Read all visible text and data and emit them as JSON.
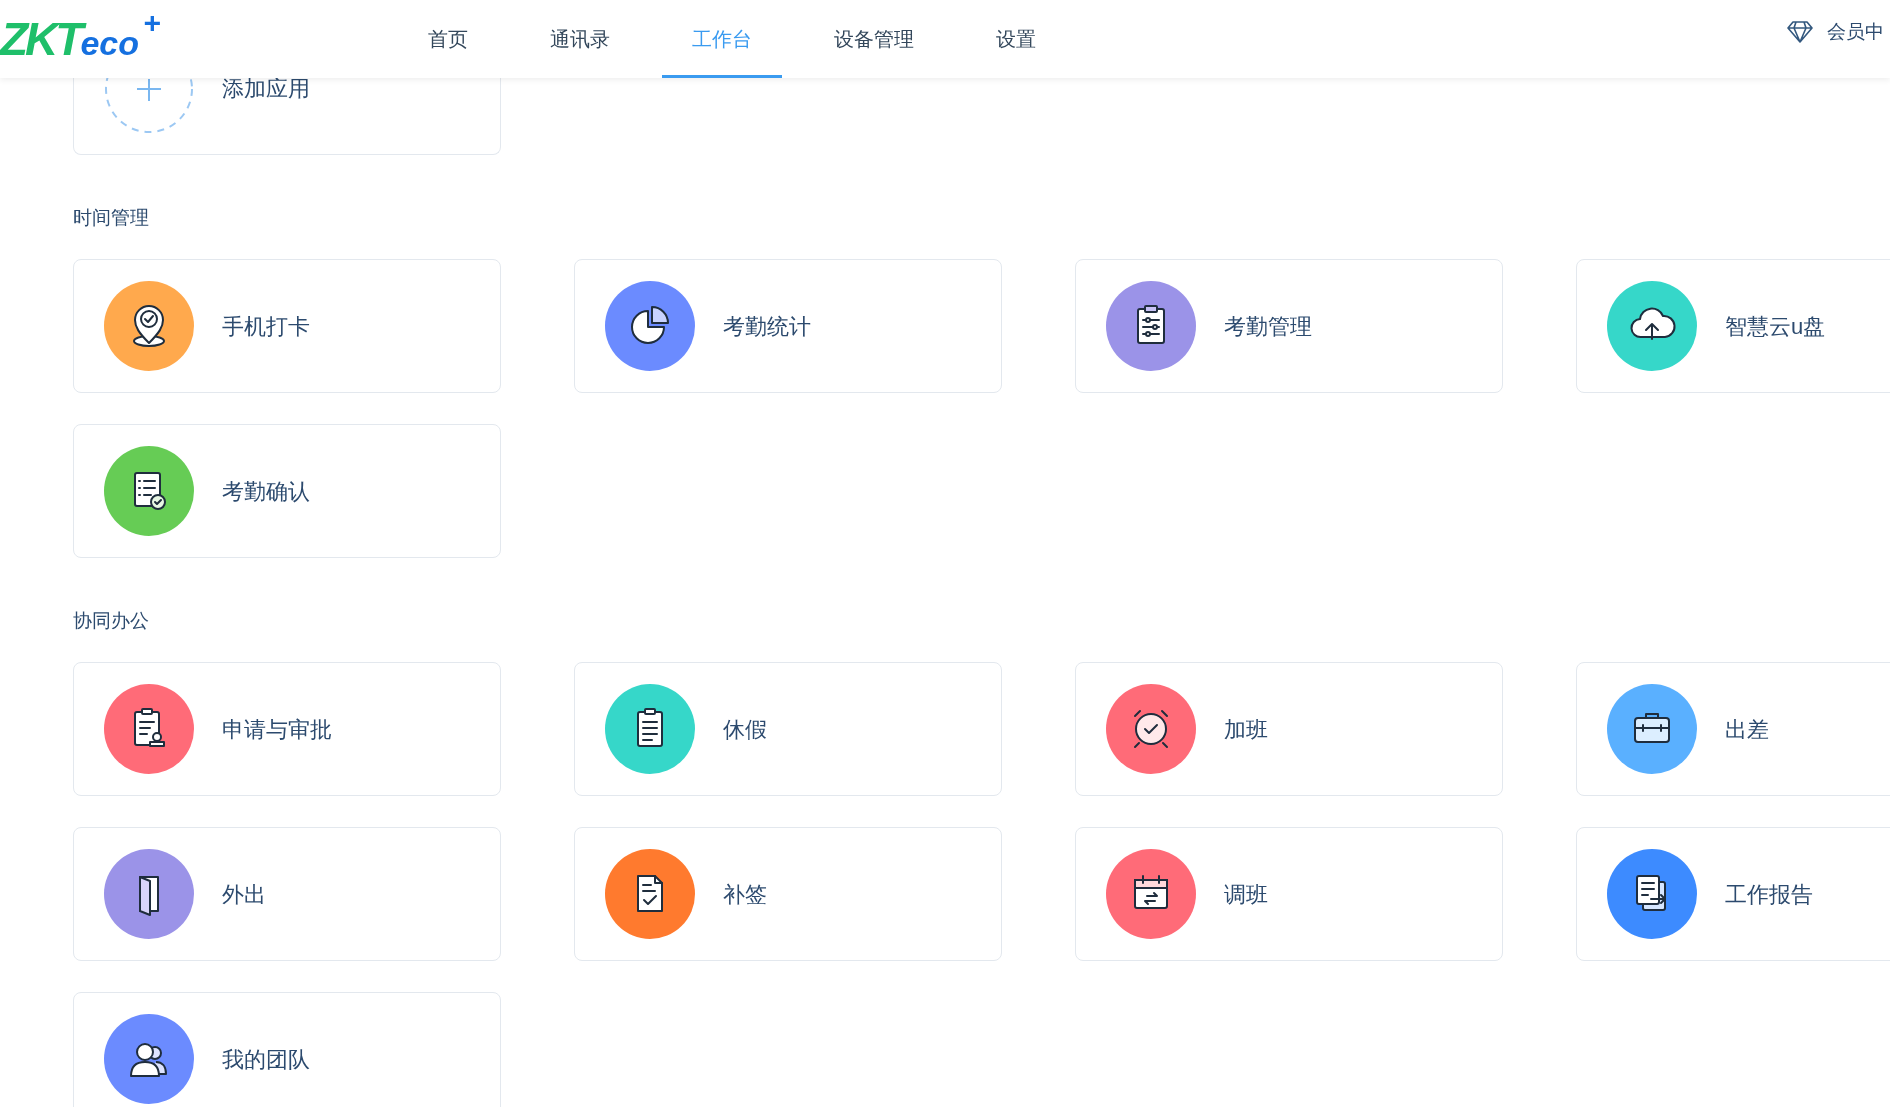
{
  "header": {
    "logo": {
      "main": "ZKT",
      "sub": "eco",
      "mark": "+"
    },
    "nav": [
      {
        "label": "首页",
        "selected": false
      },
      {
        "label": "通讯录",
        "selected": false
      },
      {
        "label": "工作台",
        "selected": true
      },
      {
        "label": "设备管理",
        "selected": false
      },
      {
        "label": "设置",
        "selected": false
      }
    ],
    "member": {
      "label": "会员中"
    }
  },
  "add_app": {
    "label": "添加应用"
  },
  "sections": [
    {
      "title": "时间管理",
      "apps": [
        {
          "label": "手机打卡",
          "kind": "pin",
          "color": "#ffa94d"
        },
        {
          "label": "考勤统计",
          "kind": "pie",
          "color": "#6b8bff"
        },
        {
          "label": "考勤管理",
          "kind": "sliders",
          "color": "#9b93e8"
        },
        {
          "label": "智慧云u盘",
          "kind": "cloud",
          "color": "#36d7c9"
        },
        {
          "label": "考勤确认",
          "kind": "checklist",
          "color": "#66cc55"
        }
      ]
    },
    {
      "title": "协同办公",
      "apps": [
        {
          "label": "申请与审批",
          "kind": "stamp",
          "color": "#ff6b78"
        },
        {
          "label": "休假",
          "kind": "notepad",
          "color": "#36d7c9"
        },
        {
          "label": "加班",
          "kind": "alarm",
          "color": "#ff6b78"
        },
        {
          "label": "出差",
          "kind": "briefcase",
          "color": "#5ab0ff"
        },
        {
          "label": "外出",
          "kind": "door",
          "color": "#9b93e8"
        },
        {
          "label": "补签",
          "kind": "doccheck",
          "color": "#ff7a2e"
        },
        {
          "label": "调班",
          "kind": "calendar",
          "color": "#ff6b78"
        },
        {
          "label": "工作报告",
          "kind": "report",
          "color": "#3d8bff"
        },
        {
          "label": "我的团队",
          "kind": "people",
          "color": "#6b8bff"
        }
      ]
    }
  ]
}
